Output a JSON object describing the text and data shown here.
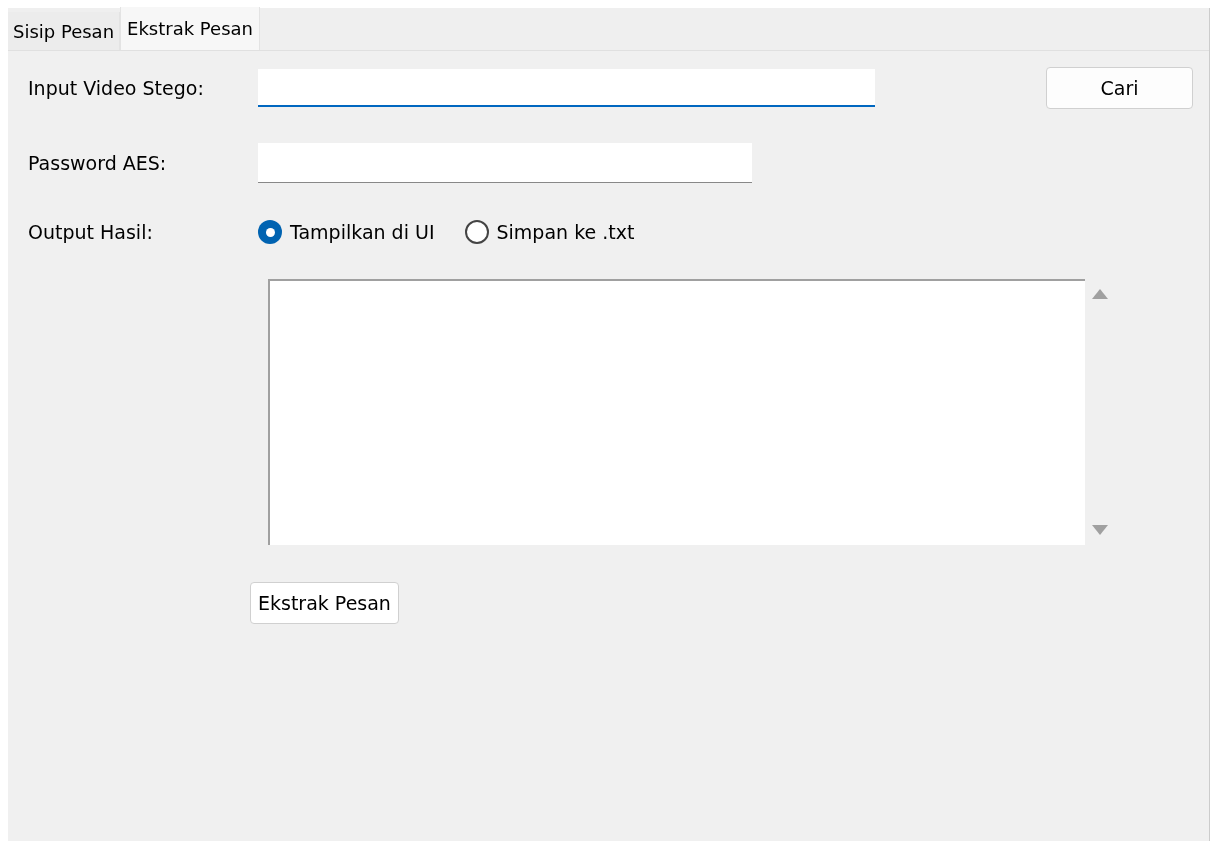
{
  "tabs": [
    {
      "label": "Sisip Pesan",
      "selected": false
    },
    {
      "label": "Ekstrak Pesan",
      "selected": true
    }
  ],
  "video_input": {
    "label": "Input Video Stego:",
    "focused": true,
    "browse_button": "Cari"
  },
  "password": {
    "label": "Password AES:"
  },
  "output": {
    "label": "Output Hasil:",
    "options": [
      {
        "label": "Tampilkan di UI",
        "selected": true
      },
      {
        "label": "Simpan ke .txt",
        "selected": false
      }
    ]
  },
  "extract_button": "Ekstrak Pesan"
}
